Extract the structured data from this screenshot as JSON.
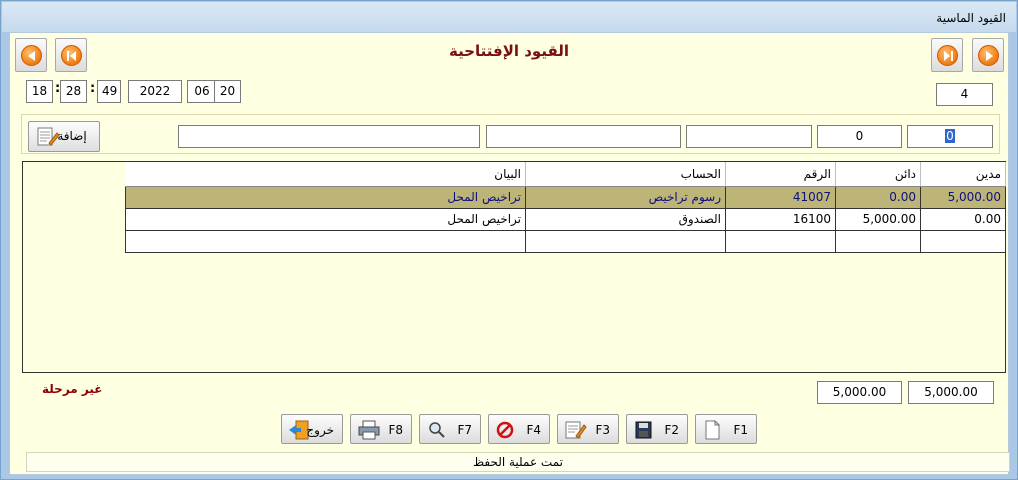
{
  "window": {
    "title": "القيود الماسية"
  },
  "form": {
    "title": "القيود الإفتتاحية"
  },
  "time": {
    "hour": "18",
    "minute": "28",
    "second": "49",
    "sep": ":"
  },
  "date": {
    "year": "2022",
    "month": "06",
    "day": "20"
  },
  "record": {
    "number": "4"
  },
  "entry": {
    "debit": "0",
    "credit": "0",
    "number": "",
    "account": "",
    "description": "",
    "add_label": "إضافة"
  },
  "grid": {
    "headers": [
      "مدين",
      "دائن",
      "الرقم",
      "الحساب",
      "البيان"
    ],
    "rows": [
      {
        "debit": "5,000.00",
        "credit": "0.00",
        "number": "41007",
        "account": "رسوم تراخيص",
        "description": "تراخيص المحل",
        "selected": true
      },
      {
        "debit": "0.00",
        "credit": "5,000.00",
        "number": "16100",
        "account": "الصندوق",
        "description": "تراخيص المحل",
        "selected": false
      },
      {
        "debit": "",
        "credit": "",
        "number": "",
        "account": "",
        "description": "",
        "selected": false
      }
    ]
  },
  "totals": {
    "debit": "5,000.00",
    "credit": "5,000.00"
  },
  "status": {
    "posting": "غير مرحلة",
    "message": "تمت عملية الحفظ"
  },
  "buttons": {
    "f1": "F1",
    "f2": "F2",
    "f3": "F3",
    "f4": "F4",
    "f7": "F7",
    "f8": "F8",
    "exit": "خروج"
  },
  "colors": {
    "title": "#7a1010",
    "selected_row": "#bdb478",
    "form_bg": "#ffffe1"
  }
}
